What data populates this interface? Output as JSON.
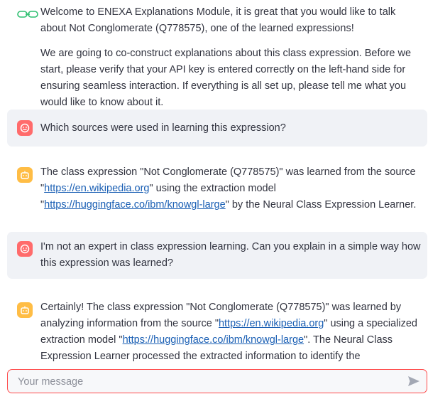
{
  "chat": {
    "welcome": {
      "paragraph1": "Welcome to ENEXA Explanations Module, it is great that you would like to talk about Not Conglomerate (Q778575), one of the learned expressions!",
      "paragraph2": "We are going to co-construct explanations about this class expression. Before we start, please verify that your API key is entered correctly on the left-hand side for ensuring seamless interaction. If everything is all set up, please tell me what you would like to know about it."
    },
    "user1": "Which sources were used in learning this expression?",
    "bot1": {
      "before": "The class expression \"Not Conglomerate (Q778575)\" was learned from the source \"",
      "link1": "https://en.wikipedia.org",
      "middle": "\" using the extraction model \"",
      "link2": "https://huggingface.co/ibm/knowgl-large",
      "after": "\" by the Neural Class Expression Learner."
    },
    "user2": "I'm not an expert in class expression learning. Can you explain in a simple way how this expression was learned?",
    "bot2": {
      "before": "Certainly! The class expression \"Not Conglomerate (Q778575)\" was learned by analyzing information from the source \"",
      "link1": "https://en.wikipedia.org",
      "middle": "\" using a specialized extraction model \"",
      "link2": "https://huggingface.co/ibm/knowgl-large",
      "after": "\". The Neural Class Expression Learner processed the extracted information to identify the characteristics and properties of entities that do not belong"
    }
  },
  "input": {
    "placeholder": "Your message"
  },
  "colors": {
    "user_avatar": "#ff6b6b",
    "bot_avatar": "#ffbd45",
    "input_border": "#ff4b4b",
    "link": "#1a5fb4"
  }
}
